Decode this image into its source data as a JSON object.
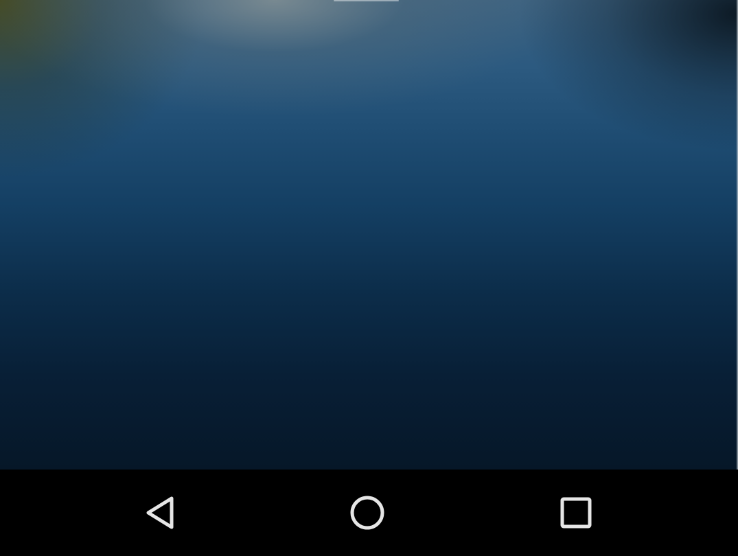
{
  "screen": {
    "wallpaper_colors": [
      "#3d6382",
      "#1f4d73",
      "#0c2d4a",
      "#061728"
    ]
  },
  "nav_bar": {
    "background": "#000000",
    "icon_color": "#e6e6e6",
    "buttons": [
      {
        "name": "back",
        "icon": "back-triangle-icon"
      },
      {
        "name": "home",
        "icon": "home-circle-icon"
      },
      {
        "name": "recents",
        "icon": "recents-square-icon"
      }
    ]
  }
}
